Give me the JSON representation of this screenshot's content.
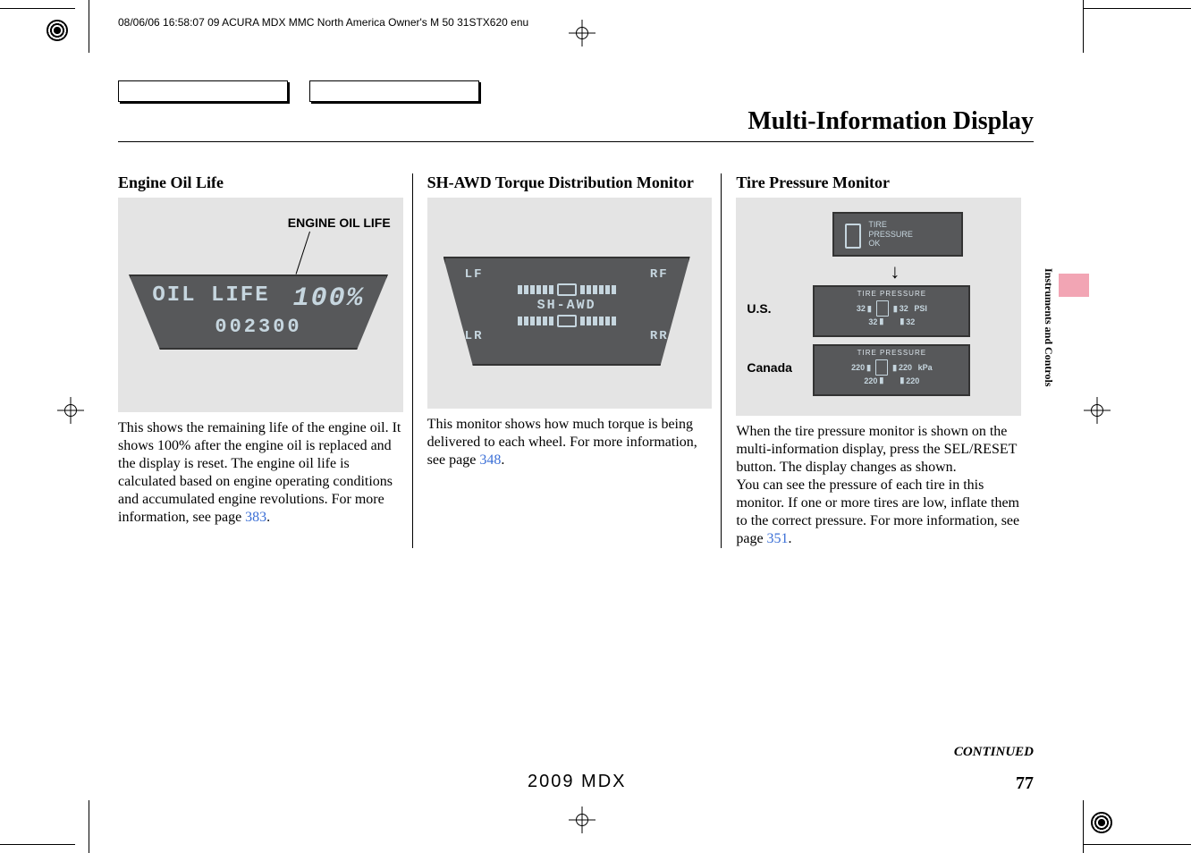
{
  "meta": "08/06/06 16:58:07   09 ACURA MDX MMC North America Owner's M 50 31STX620 enu",
  "page_title": "Multi-Information Display",
  "side_tab": "Instruments and Controls",
  "continued": "CONTINUED",
  "page_number": "77",
  "footer_model": "2009  MDX",
  "col1": {
    "heading": "Engine Oil Life",
    "fig_caption": "ENGINE OIL LIFE",
    "lcd_label": "OIL LIFE",
    "lcd_value": "100%",
    "lcd_odometer": "002300",
    "body_a": "This shows the remaining life of the engine oil. It shows 100% after the engine oil is replaced and the display is reset. The engine oil life is calculated based on engine operating conditions and accumulated engine revolutions. For more information, see page ",
    "ref": "383",
    "body_b": "."
  },
  "col2": {
    "heading": "SH-AWD Torque Distribution Monitor",
    "lf": "LF",
    "rf": "RF",
    "center": "SH-AWD",
    "lr": "LR",
    "rr": "RR",
    "body_a": "This monitor shows how much torque is being delivered to each wheel. For more information, see page ",
    "ref": "348",
    "body_b": "."
  },
  "col3": {
    "heading": "Tire Pressure Monitor",
    "label_us": "U.S.",
    "label_ca": "Canada",
    "small_line1": "TIRE",
    "small_line2": "PRESSURE",
    "small_line3": "OK",
    "panel_hdr": "TIRE PRESSURE",
    "us_vals": "32",
    "us_unit": "PSI",
    "ca_vals": "220",
    "ca_unit": "kPa",
    "body_a": "When the tire pressure monitor is shown on the multi-information display, press the SEL/RESET button. The display changes as shown.",
    "body_b": "You can see the pressure of each tire in this monitor. If one or more tires are low, inflate them to the correct pressure. For more information, see page ",
    "ref": "351",
    "body_c": "."
  }
}
